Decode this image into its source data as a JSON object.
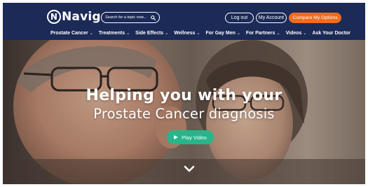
{
  "header": {
    "logo_text": "Navigate",
    "logo_mark_letter": "N",
    "search_placeholder": "Search for a topic now...",
    "logout_label": "Log out",
    "account_label": "My Account",
    "compare_label": "Compare My Options",
    "accent_color": "#f26b1d",
    "bar_color": "#1b2a57"
  },
  "nav": {
    "items": [
      {
        "label": "Prostate Cancer",
        "dropdown": "⌄"
      },
      {
        "label": "Treatments",
        "dropdown": "⌄"
      },
      {
        "label": "Side Effects",
        "dropdown": "⌄"
      },
      {
        "label": "Wellness",
        "dropdown": "⌄"
      },
      {
        "label": "For Gay Men",
        "dropdown": "⌄"
      },
      {
        "label": "For Partners",
        "dropdown": "⌄"
      },
      {
        "label": "Videos",
        "dropdown": "⌄"
      },
      {
        "label": "Ask Your Doctor",
        "dropdown": ""
      }
    ]
  },
  "hero": {
    "headline": "Helping you with your",
    "subline": "Prostate Cancer diagnosis",
    "play_label": "Play Video",
    "play_color": "#27b58a",
    "scroll_icon": "chevron-down-icon"
  }
}
